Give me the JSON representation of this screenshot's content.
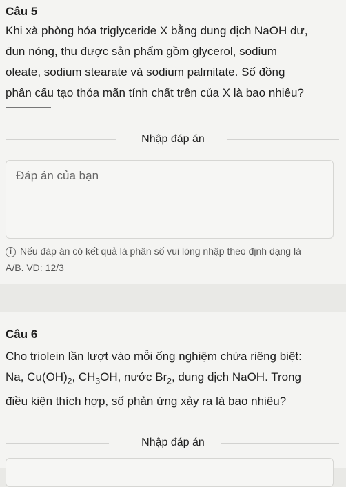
{
  "question5": {
    "title": "Câu 5",
    "lines": [
      "Khi xà phòng hóa triglyceride X bằng dung dịch NaOH dư,",
      "đun nóng, thu được sản phẩm gồm glycerol, sodium",
      "oleate, sodium stearate và sodium palmitate. Số đồng",
      "phân cấu tạo thỏa mãn tính chất trên của X là bao nhiêu?"
    ],
    "section_label": "Nhập đáp án",
    "answer_placeholder": "Đáp án của bạn",
    "hint_line1": "Nếu đáp án có kết quả là phân số vui lòng nhập theo định dạng là",
    "hint_line2": "A/B. VD: 12/3"
  },
  "question6": {
    "title": "Câu 6",
    "line1": "Cho triolein lần lượt vào mỗi ống nghiệm chứa riêng biệt:",
    "line2": {
      "na": "Na, Cu(OH)",
      "sub1": "2",
      "ch3": ", CH",
      "sub2": "3",
      "oh": "OH, nước Br",
      "sub3": "2",
      "rest": ", dung dịch NaOH. Trong"
    },
    "line3": "điều kiện thích hợp, số phản ứng xảy ra là bao nhiêu?",
    "section_label": "Nhập đáp án"
  },
  "icons": {
    "hint": "info-icon"
  },
  "colors": {
    "background": "#e9e9e6",
    "card": "#f4f4f2",
    "text": "#1f1f1f"
  }
}
